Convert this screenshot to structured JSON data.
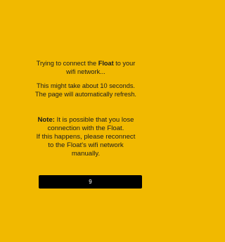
{
  "status": {
    "line1_prefix": "Trying to connect the ",
    "device_name": "Float",
    "line1_suffix": " to your",
    "line2": "wifi network..."
  },
  "wait_info": {
    "line1": "This might take about 10 seconds.",
    "line2": "The page will automatically refresh."
  },
  "note": {
    "label": "Note:",
    "line1_rest": " It is possible that you lose",
    "line2": "connection with the Float.",
    "line3": "If this happens, please reconnect",
    "line4": "to the Float's wifi network",
    "line5": "manually."
  },
  "countdown": {
    "value": "9"
  },
  "colors": {
    "background": "#f1b900",
    "text": "#1c1c1c",
    "counter_bar": "#000000",
    "counter_text": "#ffffff"
  }
}
